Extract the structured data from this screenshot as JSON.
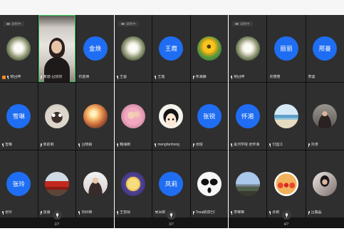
{
  "recording_label": "录制中",
  "colors": {
    "initials_avatar": "#1f6df2",
    "speaking_border": "#35c759",
    "host_badge": "#f08a24",
    "tile_background": "#2f2f2f"
  },
  "pages": [
    {
      "indicator": "2/7",
      "tiles": [
        {
          "name": "常回坤",
          "avatar": "white-flower-photo",
          "host": true,
          "recording": true,
          "mic": true
        },
        {
          "name": "教谐-吕欣欣",
          "avatar": "live-video",
          "speaking": true,
          "mic": true
        },
        {
          "name": "石金焕",
          "initials": "金焕",
          "mic": false
        },
        {
          "name": "雪琳",
          "initials": "雪琳",
          "mic": true
        },
        {
          "name": "郭前莉",
          "avatar": "cat-photo",
          "mic": true
        },
        {
          "name": "吕晓娟",
          "avatar": "sunset-person-photo",
          "mic": true
        },
        {
          "name": "张玲",
          "initials": "张玲",
          "mic": true
        },
        {
          "name": "雷蕾",
          "avatar": "red-building-photo",
          "mic": true
        },
        {
          "name": "刘科锋",
          "avatar": "portrait-light-photo",
          "mic": true
        }
      ]
    },
    {
      "indicator": "3/7",
      "tiles": [
        {
          "name": "王蓉",
          "avatar": "white-flower-photo",
          "recording": true,
          "mic": true
        },
        {
          "name": "王霞",
          "initials": "王霞",
          "mic": true
        },
        {
          "name": "朱海静",
          "avatar": "sunflower-photo",
          "mic": true
        },
        {
          "name": "鞠海卿",
          "avatar": "girl-pink-photo",
          "mic": true
        },
        {
          "name": "mengfanhong",
          "avatar": "cartoon-girl-avatar",
          "mic": true
        },
        {
          "name": "张锐",
          "initials": "张锐",
          "mic": true
        },
        {
          "name": "王慧倩",
          "avatar": "yellow-dog-photo",
          "mic": true
        },
        {
          "name": "吴凤莉",
          "initials": "凤莉",
          "mic": false
        },
        {
          "name": "Tosa航双巴I",
          "avatar": "mono-face-avatar",
          "mic": true
        }
      ]
    },
    {
      "indicator": "4/7",
      "tiles": [
        {
          "name": "常回坤",
          "avatar": "white-flower-photo",
          "recording": true,
          "mic": true
        },
        {
          "name": "贾丽丽",
          "initials": "丽丽",
          "mic": false
        },
        {
          "name": "邢曼",
          "initials": "邢曼",
          "mic": false
        },
        {
          "name": "黑河学院 张怀湘",
          "initials": "怀湘",
          "mic": true
        },
        {
          "name": "付国江",
          "avatar": "beach-photo",
          "mic": true
        },
        {
          "name": "刘涛",
          "avatar": "street-portrait-photo",
          "mic": true
        },
        {
          "name": "李琳琳",
          "avatar": "landscape-photo",
          "mic": true
        },
        {
          "name": "孙莉",
          "avatar": "anpanman-avatar",
          "mic": true
        },
        {
          "name": "吕鑫磊",
          "avatar": "portrait-dark-photo",
          "mic": true
        }
      ]
    }
  ]
}
